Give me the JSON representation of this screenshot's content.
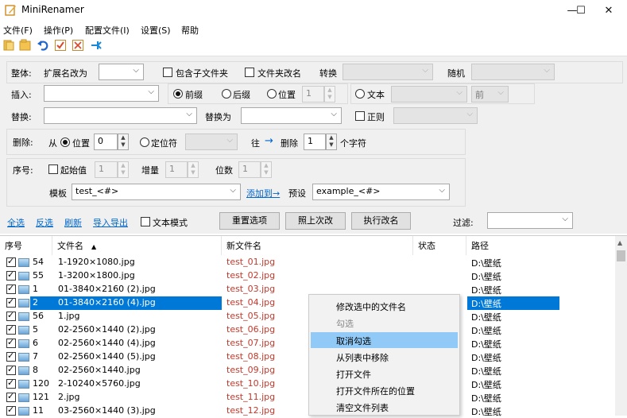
{
  "window": {
    "title": "MiniRenamer"
  },
  "window_controls": {
    "minimize": "—",
    "maximize": "☐",
    "close": "✕"
  },
  "menu": [
    "文件(F)",
    "操作(P)",
    "配置文件(I)",
    "设置(S)",
    "帮助"
  ],
  "toolbar_icons": [
    "folder-add-icon",
    "folder-open-icon",
    "undo-icon",
    "check-all-icon",
    "uncheck-icon",
    "pin-icon"
  ],
  "options": {
    "overall": {
      "label": "整体:",
      "ext_label": "扩展名改为",
      "ext_value": "",
      "subfolder": "包含子文件夹",
      "folder_rename": "文件夹改名",
      "convert": "转换",
      "convert_value": "",
      "random": "随机",
      "random_value": ""
    },
    "insert": {
      "label": "插入:",
      "value": "",
      "prefix": "前缀",
      "suffix": "后缀",
      "position": "位置",
      "position_value": "1",
      "text": "文本",
      "text_value": "",
      "dir_value": "前"
    },
    "replace": {
      "label": "替换:",
      "value": "",
      "replace_with": "替换为",
      "replace_value": "",
      "regex": "正则",
      "regex_value": ""
    },
    "delete": {
      "label": "删除:",
      "from": "从",
      "position": "位置",
      "position_value": "0",
      "locator": "定位符",
      "locator_value": "",
      "to": "往",
      "arrow": "→",
      "delete": "删除",
      "count": "1",
      "chars": "个字符"
    },
    "sequence": {
      "label": "序号:",
      "start": "起始值",
      "start_value": "1",
      "increment": "增量",
      "increment_value": "1",
      "digits": "位数",
      "digits_value": "1",
      "template": "模板",
      "template_value": "test_<#>",
      "add_to": "添加到→",
      "preset": "预设",
      "preset_value": "example_<#>"
    }
  },
  "actions": {
    "select_all": "全选",
    "invert": "反选",
    "refresh": "刷新",
    "import_export": "导入导出",
    "text_mode": "文本模式",
    "reset": "重置选项",
    "last": "照上次改",
    "execute": "执行改名",
    "filter": "过滤:",
    "filter_value": ""
  },
  "columns": {
    "index": "序号",
    "filename": "文件名",
    "sort_arrow": "▲",
    "newname": "新文件名",
    "status": "状态",
    "path": "路径"
  },
  "rows": [
    {
      "idx": "54",
      "name": "1-1920×1080.jpg",
      "new": "test_01.jpg",
      "path": "D:\\壁纸"
    },
    {
      "idx": "55",
      "name": "1-3200×1800.jpg",
      "new": "test_02.jpg",
      "path": "D:\\壁纸"
    },
    {
      "idx": "1",
      "name": "01-3840×2160 (2).jpg",
      "new": "test_03.jpg",
      "path": "D:\\壁纸"
    },
    {
      "idx": "2",
      "name": "01-3840×2160 (4).jpg",
      "new": "test_04.jpg",
      "path": "D:\\壁纸"
    },
    {
      "idx": "56",
      "name": "1.jpg",
      "new": "test_05.jpg",
      "path": "D:\\壁纸"
    },
    {
      "idx": "5",
      "name": "02-2560×1440 (2).jpg",
      "new": "test_06.jpg",
      "path": "D:\\壁纸"
    },
    {
      "idx": "6",
      "name": "02-2560×1440 (4).jpg",
      "new": "test_07.jpg",
      "path": "D:\\壁纸"
    },
    {
      "idx": "7",
      "name": "02-2560×1440 (5).jpg",
      "new": "test_08.jpg",
      "path": "D:\\壁纸"
    },
    {
      "idx": "8",
      "name": "02-2560×1440.jpg",
      "new": "test_09.jpg",
      "path": "D:\\壁纸"
    },
    {
      "idx": "120",
      "name": "2-10240×5760.jpg",
      "new": "test_10.jpg",
      "path": "D:\\壁纸"
    },
    {
      "idx": "121",
      "name": "2.jpg",
      "new": "test_11.jpg",
      "path": "D:\\壁纸"
    },
    {
      "idx": "11",
      "name": "03-2560×1440 (3).jpg",
      "new": "test_12.jpg",
      "path": "D:\\壁纸"
    }
  ],
  "selected_row": 3,
  "context_menu": [
    {
      "label": "修改选中的文件名",
      "state": "normal"
    },
    {
      "label": "勾选",
      "state": "disabled"
    },
    {
      "label": "取消勾选",
      "state": "highlight"
    },
    {
      "label": "从列表中移除",
      "state": "normal"
    },
    {
      "label": "打开文件",
      "state": "normal"
    },
    {
      "label": "打开文件所在的位置",
      "state": "normal"
    },
    {
      "label": "清空文件列表",
      "state": "normal"
    }
  ],
  "colors": {
    "selection": "#0078d7",
    "link": "#0066cc",
    "new_name": "#c0392b",
    "menu_highlight": "#91c9f7"
  }
}
